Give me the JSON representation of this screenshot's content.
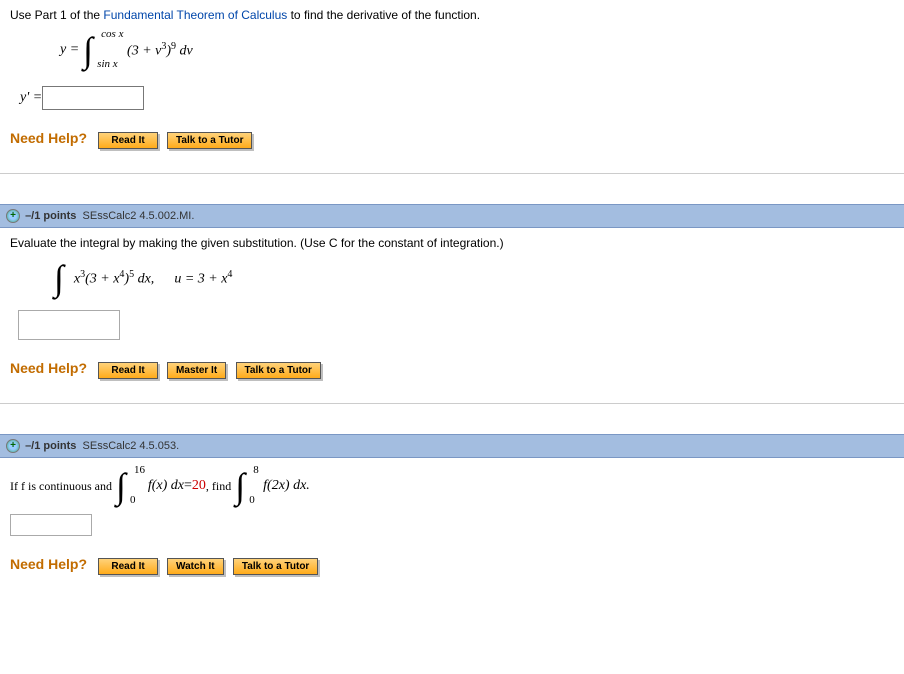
{
  "q1": {
    "prompt_pre": "Use Part 1 of the ",
    "link": "Fundamental Theorem of Calculus",
    "prompt_post": " to find the derivative of the function.",
    "ylabel": "y = ",
    "upper": "cos x",
    "lower": "sin x",
    "integrand": "(3 + v",
    "integrand_exp1": "3",
    "integrand_mid": ")",
    "integrand_exp2": "9",
    "integrand_end": " dv",
    "answer_label": "y' = ",
    "help": "Need Help?",
    "btn_read": "Read It",
    "btn_tutor": "Talk to a Tutor"
  },
  "q2": {
    "points": "–/1 points",
    "ref": "SEssCalc2 4.5.002.MI.",
    "prompt": "Evaluate the integral by making the given substitution. (Use C for the constant of integration.)",
    "integrand_a": "x",
    "exp_a": "3",
    "integrand_b": "(3 + x",
    "exp_b": "4",
    "integrand_c": ")",
    "exp_c": "5",
    "integrand_d": " dx,",
    "sub_lhs": "u = 3 + x",
    "sub_exp": "4",
    "help": "Need Help?",
    "btn_read": "Read It",
    "btn_master": "Master It",
    "btn_tutor": "Talk to a Tutor"
  },
  "q3": {
    "points": "–/1 points",
    "ref": "SEssCalc2 4.5.053.",
    "pre": "If f is continuous and ",
    "up1": "16",
    "lo1": "0",
    "mid1a": "f(x) dx",
    "eq": " = ",
    "val": "20",
    "mid1b": ",  find ",
    "up2": "8",
    "lo2": "0",
    "mid2": "f(2x) dx.",
    "help": "Need Help?",
    "btn_read": "Read It",
    "btn_watch": "Watch It",
    "btn_tutor": "Talk to a Tutor"
  }
}
